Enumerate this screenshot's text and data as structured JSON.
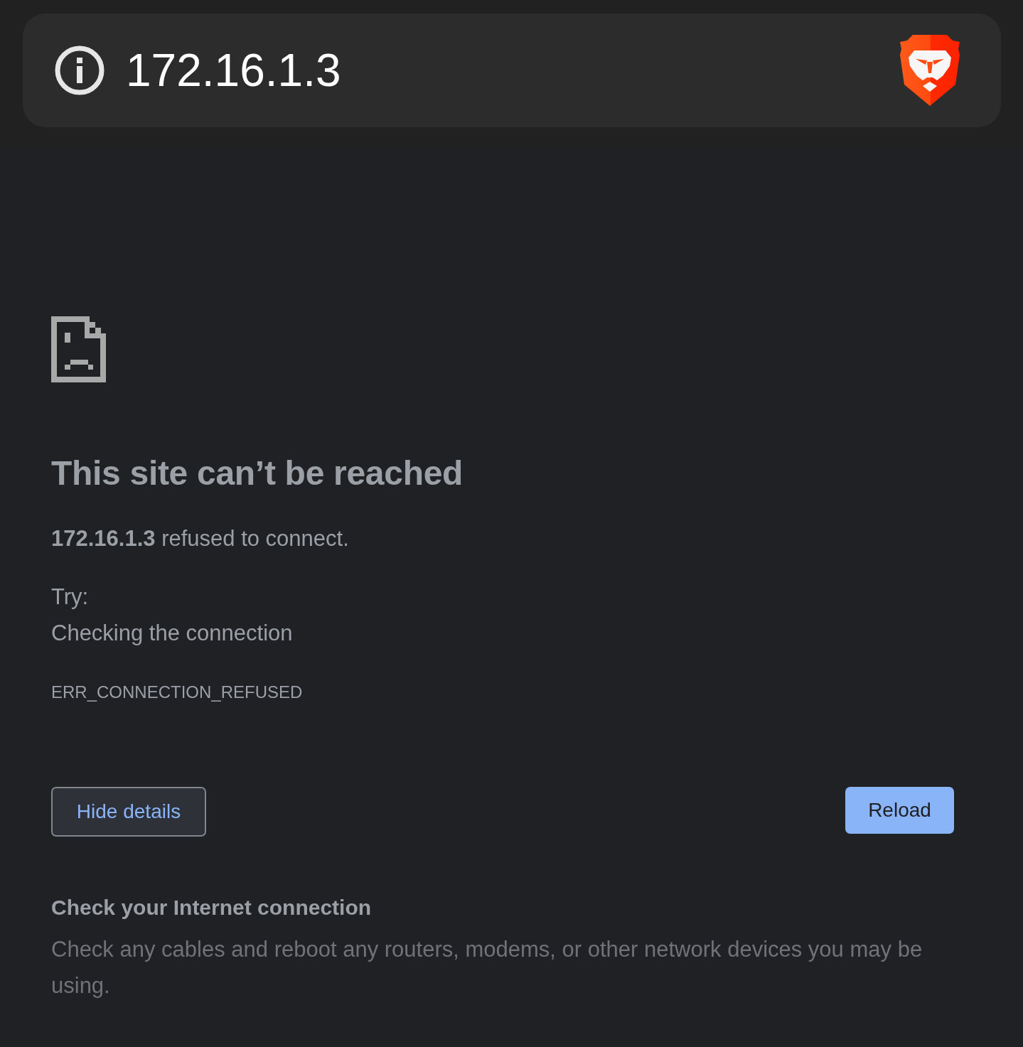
{
  "address_bar": {
    "url": "172.16.1.3"
  },
  "error_page": {
    "title": "This site can’t be reached",
    "message": "**172.16.1.3** refused to connect.",
    "try_label": "Try:",
    "suggestions": [
      "Checking the connection"
    ],
    "error_code": "ERR_CONNECTION_REFUSED"
  },
  "buttons": [
    {
      "label": "Hide details",
      "kind": "secondary"
    },
    {
      "label": "Reload",
      "kind": "primary"
    }
  ],
  "details": {
    "heading": "Check your Internet connection",
    "body": "Check any cables and reboot any routers, modems, or other network devices you may be using."
  }
}
